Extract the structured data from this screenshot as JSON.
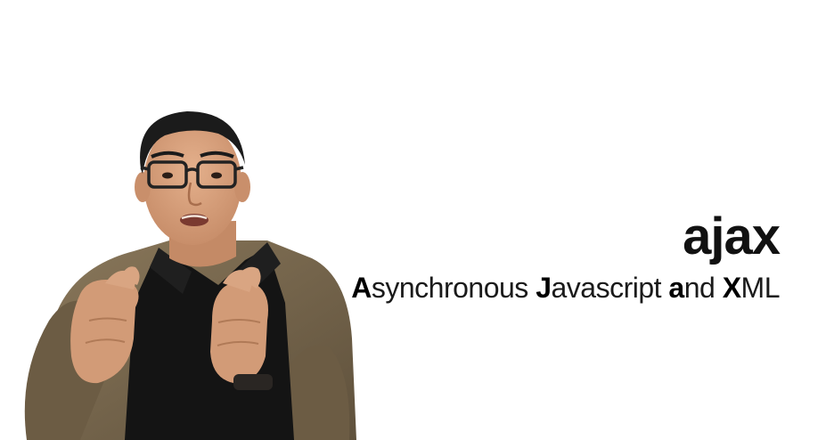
{
  "slide": {
    "title": "ajax",
    "subtitle_parts": [
      {
        "text": "A",
        "highlight": true
      },
      {
        "text": "synchronous ",
        "highlight": false
      },
      {
        "text": "J",
        "highlight": true
      },
      {
        "text": "avascript ",
        "highlight": false
      },
      {
        "text": "a",
        "highlight": true
      },
      {
        "text": "nd ",
        "highlight": false
      },
      {
        "text": "X",
        "highlight": true
      },
      {
        "text": "ML",
        "highlight": false
      }
    ]
  },
  "colors": {
    "background": "#ffffff",
    "text": "#111111",
    "skin": "#d9a27e",
    "jacket": "#7b6a4f",
    "shirt": "#111111",
    "hair": "#1b1b1b"
  }
}
